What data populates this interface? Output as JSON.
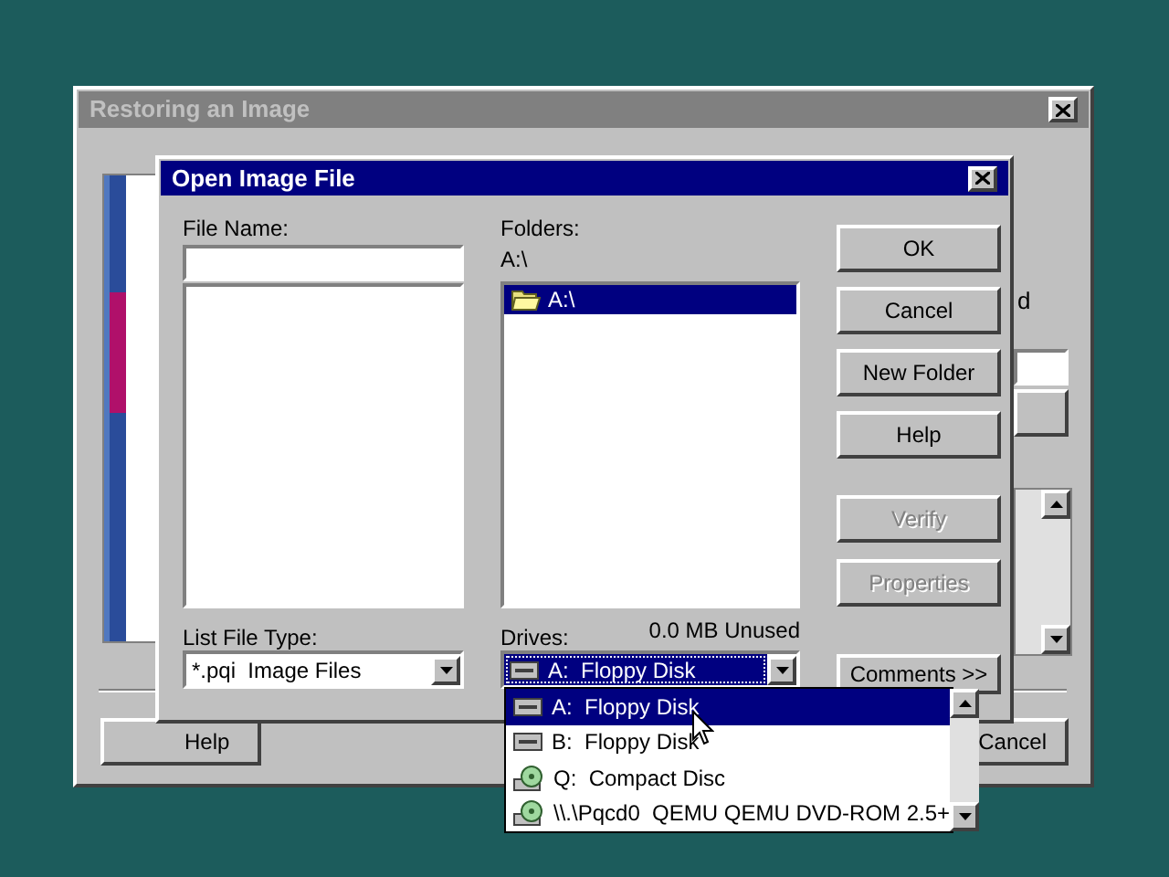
{
  "background_window": {
    "title": "Restoring an Image",
    "fragment_text": "d",
    "buttons": [
      {
        "label": "Help"
      },
      {
        "label": "Cancel"
      }
    ]
  },
  "dialog": {
    "title": "Open Image File",
    "file_name": {
      "label": "File Name:"
    },
    "list_file_type": {
      "label": "List File Type:",
      "value": "*.pqi  Image Files"
    },
    "folders": {
      "label": "Folders:",
      "path": "A:\\",
      "items": [
        {
          "label": "A:\\",
          "selected": true
        }
      ]
    },
    "drives": {
      "label": "Drives:",
      "free": "0.0 MB Unused",
      "value": "A:  Floppy Disk",
      "kind": "floppy"
    },
    "buttons": [
      {
        "label": "OK",
        "disabled": false
      },
      {
        "label": "Cancel",
        "disabled": false
      },
      {
        "label": "New Folder",
        "disabled": false
      },
      {
        "label": "Help",
        "disabled": false
      },
      {
        "label": "Verify",
        "disabled": true
      },
      {
        "label": "Properties",
        "disabled": true
      },
      {
        "label": "Comments >>",
        "disabled": false
      }
    ]
  },
  "drive_list": {
    "items": [
      {
        "label": "A:  Floppy Disk",
        "kind": "floppy",
        "selected": true
      },
      {
        "label": "B:  Floppy Disk",
        "kind": "floppy",
        "selected": false
      },
      {
        "label": "Q:  Compact Disc",
        "kind": "cd",
        "selected": false
      },
      {
        "label": "\\\\.\\Pqcd0  QEMU QEMU DVD-ROM 2.5+",
        "kind": "cd",
        "selected": false
      }
    ]
  }
}
